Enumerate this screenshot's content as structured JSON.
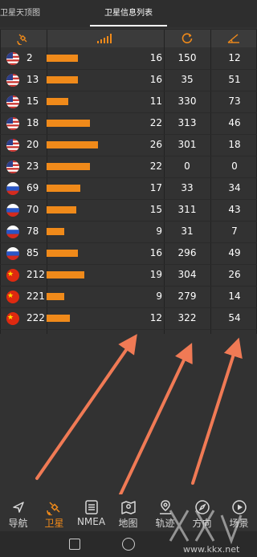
{
  "tabs": [
    {
      "label": "卫星天顶图"
    },
    {
      "label": "卫星信息列表"
    }
  ],
  "header_icons": [
    "satellite-icon",
    "signal-strength-icon",
    "azimuth-icon",
    "elevation-icon"
  ],
  "colors": {
    "accent": "#f08a1a",
    "background": "#323232"
  },
  "satellites": [
    {
      "flag": "us",
      "id": "2",
      "snr": "16",
      "azimuth": "150",
      "elevation": "12"
    },
    {
      "flag": "us",
      "id": "13",
      "snr": "16",
      "azimuth": "35",
      "elevation": "51"
    },
    {
      "flag": "us",
      "id": "15",
      "snr": "11",
      "azimuth": "330",
      "elevation": "73"
    },
    {
      "flag": "us",
      "id": "18",
      "snr": "22",
      "azimuth": "313",
      "elevation": "46"
    },
    {
      "flag": "us",
      "id": "20",
      "snr": "26",
      "azimuth": "301",
      "elevation": "18"
    },
    {
      "flag": "us",
      "id": "23",
      "snr": "22",
      "azimuth": "0",
      "elevation": "0"
    },
    {
      "flag": "ru",
      "id": "69",
      "snr": "17",
      "azimuth": "33",
      "elevation": "34"
    },
    {
      "flag": "ru",
      "id": "70",
      "snr": "15",
      "azimuth": "311",
      "elevation": "43"
    },
    {
      "flag": "ru",
      "id": "78",
      "snr": "9",
      "azimuth": "31",
      "elevation": "7"
    },
    {
      "flag": "ru",
      "id": "85",
      "snr": "16",
      "azimuth": "296",
      "elevation": "49"
    },
    {
      "flag": "cn",
      "id": "212",
      "snr": "19",
      "azimuth": "304",
      "elevation": "26"
    },
    {
      "flag": "cn",
      "id": "221",
      "snr": "9",
      "azimuth": "279",
      "elevation": "14"
    },
    {
      "flag": "cn",
      "id": "222",
      "snr": "12",
      "azimuth": "322",
      "elevation": "54"
    }
  ],
  "bottom_nav": [
    {
      "label": "导航",
      "icon": "navigation-icon",
      "active": false
    },
    {
      "label": "卫星",
      "icon": "satellite-icon",
      "active": true
    },
    {
      "label": "NMEA",
      "icon": "nmea-icon",
      "active": false
    },
    {
      "label": "地图",
      "icon": "map-icon",
      "active": false
    },
    {
      "label": "轨迹",
      "icon": "track-icon",
      "active": false
    },
    {
      "label": "方向",
      "icon": "compass-icon",
      "active": false
    },
    {
      "label": "场景",
      "icon": "scene-icon",
      "active": false
    }
  ],
  "watermark": {
    "text": "www.kkx.net"
  }
}
